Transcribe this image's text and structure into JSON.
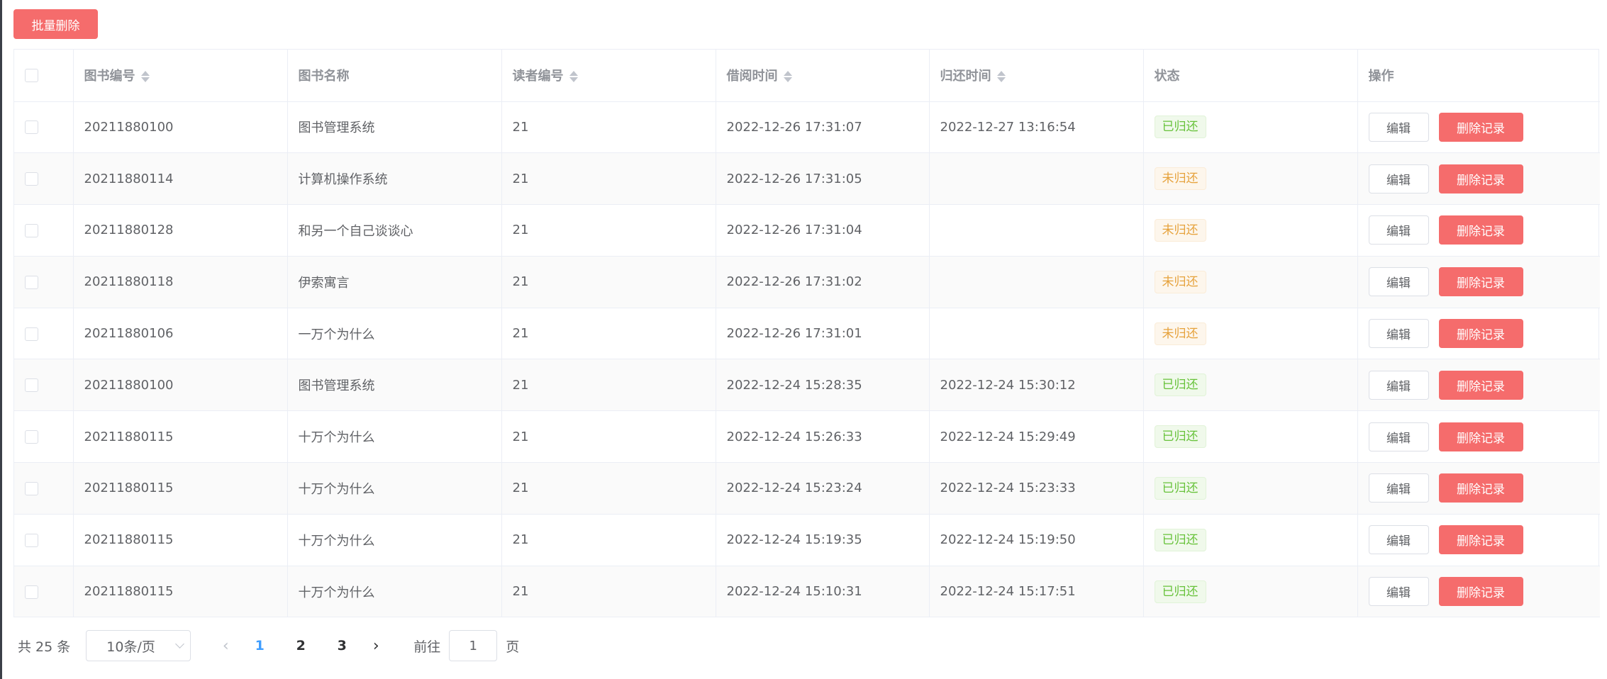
{
  "toolbar": {
    "batch_delete_label": "批量删除"
  },
  "table": {
    "headers": {
      "book_id": "图书编号",
      "book_name": "图书名称",
      "reader_id": "读者编号",
      "borrow_time": "借阅时间",
      "return_time": "归还时间",
      "status": "状态",
      "actions": "操作"
    },
    "rows": [
      {
        "book_id": "20211880100",
        "book_name": "图书管理系统",
        "reader_id": "21",
        "borrow_time": "2022-12-26 17:31:07",
        "return_time": "2022-12-27 13:16:54",
        "status": "已归还",
        "status_type": "success"
      },
      {
        "book_id": "20211880114",
        "book_name": "计算机操作系统",
        "reader_id": "21",
        "borrow_time": "2022-12-26 17:31:05",
        "return_time": "",
        "status": "未归还",
        "status_type": "warning"
      },
      {
        "book_id": "20211880128",
        "book_name": "和另一个自己谈谈心",
        "reader_id": "21",
        "borrow_time": "2022-12-26 17:31:04",
        "return_time": "",
        "status": "未归还",
        "status_type": "warning"
      },
      {
        "book_id": "20211880118",
        "book_name": "伊索寓言",
        "reader_id": "21",
        "borrow_time": "2022-12-26 17:31:02",
        "return_time": "",
        "status": "未归还",
        "status_type": "warning"
      },
      {
        "book_id": "20211880106",
        "book_name": "一万个为什么",
        "reader_id": "21",
        "borrow_time": "2022-12-26 17:31:01",
        "return_time": "",
        "status": "未归还",
        "status_type": "warning"
      },
      {
        "book_id": "20211880100",
        "book_name": "图书管理系统",
        "reader_id": "21",
        "borrow_time": "2022-12-24 15:28:35",
        "return_time": "2022-12-24 15:30:12",
        "status": "已归还",
        "status_type": "success"
      },
      {
        "book_id": "20211880115",
        "book_name": "十万个为什么",
        "reader_id": "21",
        "borrow_time": "2022-12-24 15:26:33",
        "return_time": "2022-12-24 15:29:49",
        "status": "已归还",
        "status_type": "success"
      },
      {
        "book_id": "20211880115",
        "book_name": "十万个为什么",
        "reader_id": "21",
        "borrow_time": "2022-12-24 15:23:24",
        "return_time": "2022-12-24 15:23:33",
        "status": "已归还",
        "status_type": "success"
      },
      {
        "book_id": "20211880115",
        "book_name": "十万个为什么",
        "reader_id": "21",
        "borrow_time": "2022-12-24 15:19:35",
        "return_time": "2022-12-24 15:19:50",
        "status": "已归还",
        "status_type": "success"
      },
      {
        "book_id": "20211880115",
        "book_name": "十万个为什么",
        "reader_id": "21",
        "borrow_time": "2022-12-24 15:10:31",
        "return_time": "2022-12-24 15:17:51",
        "status": "已归还",
        "status_type": "success"
      }
    ],
    "row_actions": {
      "edit_label": "编辑",
      "delete_label": "删除记录"
    }
  },
  "pagination": {
    "total_label": "共 25 条",
    "page_size_value": "10条/页",
    "pages": [
      "1",
      "2",
      "3"
    ],
    "current_page": "1",
    "goto_label": "前往",
    "goto_value": "1",
    "page_suffix": "页",
    "prev_icon": "chevron-left-icon",
    "next_icon": "chevron-right-icon"
  },
  "colors": {
    "danger": "#f56c6c",
    "success_text": "#67c23a",
    "warning_text": "#e6a23c",
    "primary": "#409eff"
  }
}
